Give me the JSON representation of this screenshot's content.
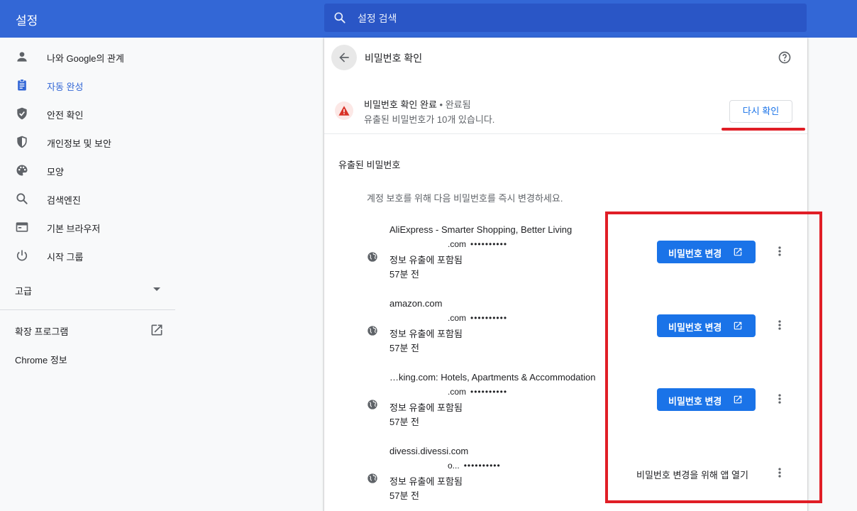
{
  "header": {
    "title": "설정",
    "search_placeholder": "설정 검색"
  },
  "sidebar": {
    "items": [
      {
        "label": "나와 Google의 관계",
        "icon": "person-icon"
      },
      {
        "label": "자동 완성",
        "icon": "clipboard-icon",
        "active": true
      },
      {
        "label": "안전 확인",
        "icon": "shield-check-icon"
      },
      {
        "label": "개인정보 및 보안",
        "icon": "shield-half-icon"
      },
      {
        "label": "모양",
        "icon": "palette-icon"
      },
      {
        "label": "검색엔진",
        "icon": "search-icon"
      },
      {
        "label": "기본 브라우저",
        "icon": "browser-window-icon"
      },
      {
        "label": "시작 그룹",
        "icon": "power-icon"
      }
    ],
    "advanced_label": "고급",
    "extensions_label": "확장 프로그램",
    "about_label": "Chrome 정보"
  },
  "main": {
    "subpage_title": "비밀번호 확인",
    "status": {
      "title": "비밀번호 확인 완료",
      "separator": " • ",
      "state": "완료됨",
      "summary": "유출된 비밀번호가 10개 있습니다.",
      "recheck_label": "다시 확인"
    },
    "section_title": "유출된 비밀번호",
    "section_desc": "계정 보호를 위해 다음 비밀번호를 즉시 변경하세요.",
    "entries": [
      {
        "site": "AliExpress - Smarter Shopping, Better Living",
        "user_suffix": ".com",
        "password": "••••••••••",
        "reason": "정보 유출에 포함됨",
        "time": "57분 전",
        "action": "비밀번호 변경"
      },
      {
        "site": "amazon.com",
        "user_suffix": ".com",
        "password": "••••••••••",
        "reason": "정보 유출에 포함됨",
        "time": "57분 전",
        "action": "비밀번호 변경"
      },
      {
        "site": "…king.com: Hotels, Apartments & Accommodation",
        "user_suffix": ".com",
        "password": "••••••••••",
        "reason": "정보 유출에 포함됨",
        "time": "57분 전",
        "action": "비밀번호 변경"
      },
      {
        "site": "divessi.divessi.com",
        "user_suffix": "o...",
        "password": "••••••••••",
        "reason": "정보 유출에 포함됨",
        "time": "57분 전",
        "action": "비밀번호 변경을 위해 앱 열기"
      }
    ]
  },
  "colors": {
    "header_bg": "#3367d6",
    "accent": "#1a73e8",
    "warning_red": "#d93025",
    "annotation_red": "#e01e26"
  }
}
